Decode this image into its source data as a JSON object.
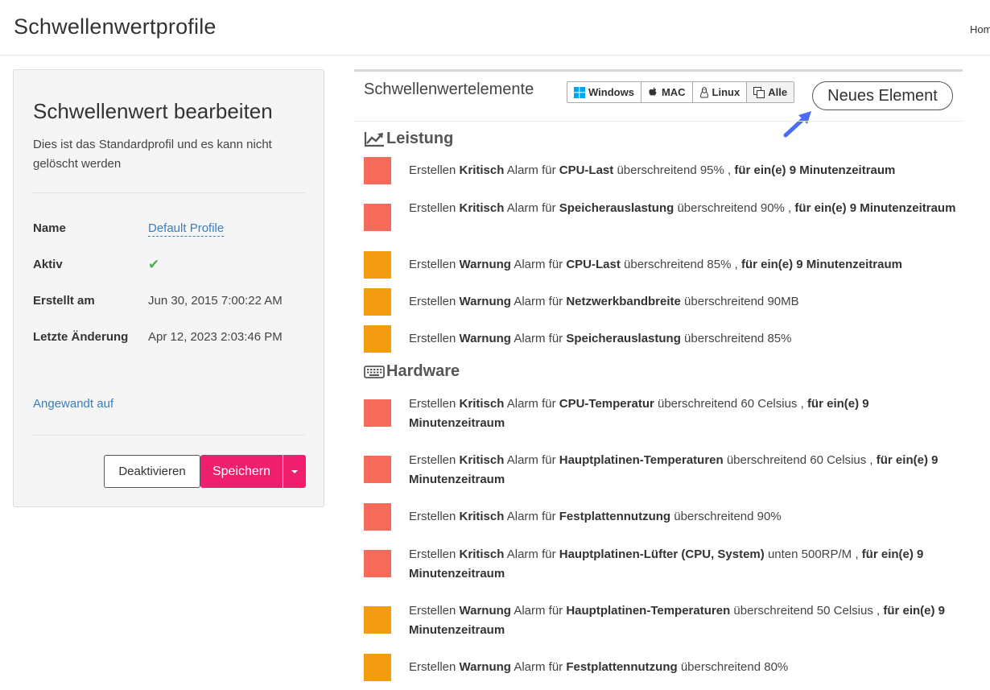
{
  "header": {
    "title": "Schwellenwertprofile",
    "home": "Home"
  },
  "edit_panel": {
    "title": "Schwellenwert bearbeiten",
    "description": "Dies ist das Standardprofil und es kann nicht gelöscht werden",
    "fields": [
      {
        "label": "Name",
        "value": "Default Profile"
      },
      {
        "label": "Aktiv",
        "value": "✔"
      },
      {
        "label": "Erstellt am",
        "value": "Jun 30, 2015 7:00:22 AM"
      },
      {
        "label": "Letzte Änderung",
        "value": "Apr 12, 2023 2:03:46 PM"
      }
    ],
    "applied_link": "Angewandt auf",
    "deactivate_label": "Deaktivieren",
    "save_label": "Speichern"
  },
  "elements_panel": {
    "title": "Schwellenwertelemente",
    "os_filters": [
      "Windows",
      "MAC",
      "Linux",
      "Alle"
    ],
    "active_filter": "Alle",
    "new_button": "Neues Element",
    "sections": [
      {
        "title": "Leistung",
        "icon": "line-chart-icon",
        "rules": [
          {
            "severity": "critical",
            "prefix": "Erstellen",
            "level": "Kritisch",
            "mid": "Alarm für",
            "metric": "CPU-Last",
            "condition": "überschreitend 95% ,",
            "duration": "für ein(e) 9 Minutenzeitraum"
          },
          {
            "severity": "critical",
            "prefix": "Erstellen",
            "level": "Kritisch",
            "mid": "Alarm für",
            "metric": "Speicherauslastung",
            "condition": "überschreitend 90% ,",
            "duration": "für ein(e) 9 Minutenzeitraum"
          },
          {
            "severity": "warning",
            "prefix": "Erstellen",
            "level": "Warnung",
            "mid": "Alarm für",
            "metric": "CPU-Last",
            "condition": "überschreitend 85% ,",
            "duration": "für ein(e) 9 Minutenzeitraum"
          },
          {
            "severity": "warning",
            "prefix": "Erstellen",
            "level": "Warnung",
            "mid": "Alarm für",
            "metric": "Netzwerkbandbreite",
            "condition": "überschreitend 90MB",
            "duration": ""
          },
          {
            "severity": "warning",
            "prefix": "Erstellen",
            "level": "Warnung",
            "mid": "Alarm für",
            "metric": "Speicherauslastung",
            "condition": "überschreitend 85%",
            "duration": ""
          }
        ]
      },
      {
        "title": "Hardware",
        "icon": "keyboard-icon",
        "rules": [
          {
            "severity": "critical",
            "prefix": "Erstellen",
            "level": "Kritisch",
            "mid": "Alarm für",
            "metric": "CPU-Temperatur",
            "condition": "überschreitend 60 Celsius ,",
            "duration": "für ein(e) 9 Minutenzeitraum"
          },
          {
            "severity": "critical",
            "prefix": "Erstellen",
            "level": "Kritisch",
            "mid": "Alarm für",
            "metric": "Hauptplatinen-Temperaturen",
            "condition": "überschreitend 60 Celsius ,",
            "duration": "für ein(e) 9 Minutenzeitraum"
          },
          {
            "severity": "critical",
            "prefix": "Erstellen",
            "level": "Kritisch",
            "mid": "Alarm für",
            "metric": "Festplattennutzung",
            "condition": "überschreitend 90%",
            "duration": ""
          },
          {
            "severity": "critical",
            "prefix": "Erstellen",
            "level": "Kritisch",
            "mid": "Alarm für",
            "metric": "Hauptplatinen-Lüfter (CPU, System)",
            "condition": "unten 500RP/M ,",
            "duration": "für ein(e) 9 Minutenzeitraum"
          },
          {
            "severity": "warning",
            "prefix": "Erstellen",
            "level": "Warnung",
            "mid": "Alarm für",
            "metric": "Hauptplatinen-Temperaturen",
            "condition": "überschreitend 50 Celsius ,",
            "duration": "für ein(e) 9 Minutenzeitraum"
          },
          {
            "severity": "warning",
            "prefix": "Erstellen",
            "level": "Warnung",
            "mid": "Alarm für",
            "metric": "Festplattennutzung",
            "condition": "überschreitend 80%",
            "duration": ""
          }
        ]
      }
    ]
  },
  "colors": {
    "critical": "#f56a5a",
    "warning": "#f39c12",
    "accent": "#ef1f6e",
    "link": "#3b7dbf"
  }
}
